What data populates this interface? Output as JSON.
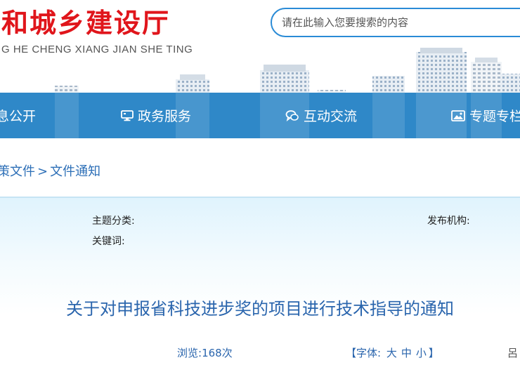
{
  "header": {
    "site_title": "和城乡建设厅",
    "site_title_pinyin": "G HE CHENG XIANG JIAN SHE TING",
    "search_placeholder": "请在此输入您要搜索的内容"
  },
  "nav": {
    "items": [
      {
        "label": "息公开",
        "icon": "none"
      },
      {
        "label": "政务服务",
        "icon": "monitor-icon"
      },
      {
        "label": "互动交流",
        "icon": "chat-icon"
      },
      {
        "label": "专题专栏",
        "icon": "image-icon"
      }
    ]
  },
  "breadcrumb": {
    "items": [
      "策文件",
      "文件通知"
    ],
    "separator": ">"
  },
  "article": {
    "meta": {
      "subject_label": "主题分类:",
      "keywords_label": "关键词:",
      "publisher_label": "发布机构:"
    },
    "title": "关于对申报省科技进步奖的项目进行技术指导的通知",
    "views_label": "浏览:",
    "views_count": "168",
    "views_unit": "次",
    "font_label": "【字体:",
    "font_large": "大",
    "font_medium": "中",
    "font_small": "小",
    "font_close": "】",
    "trailing_text": "呂"
  },
  "colors": {
    "title_red": "#e0151b",
    "nav_blue": "#2f88c8",
    "link_blue": "#2a65ad",
    "search_border": "#2a8bd6"
  }
}
